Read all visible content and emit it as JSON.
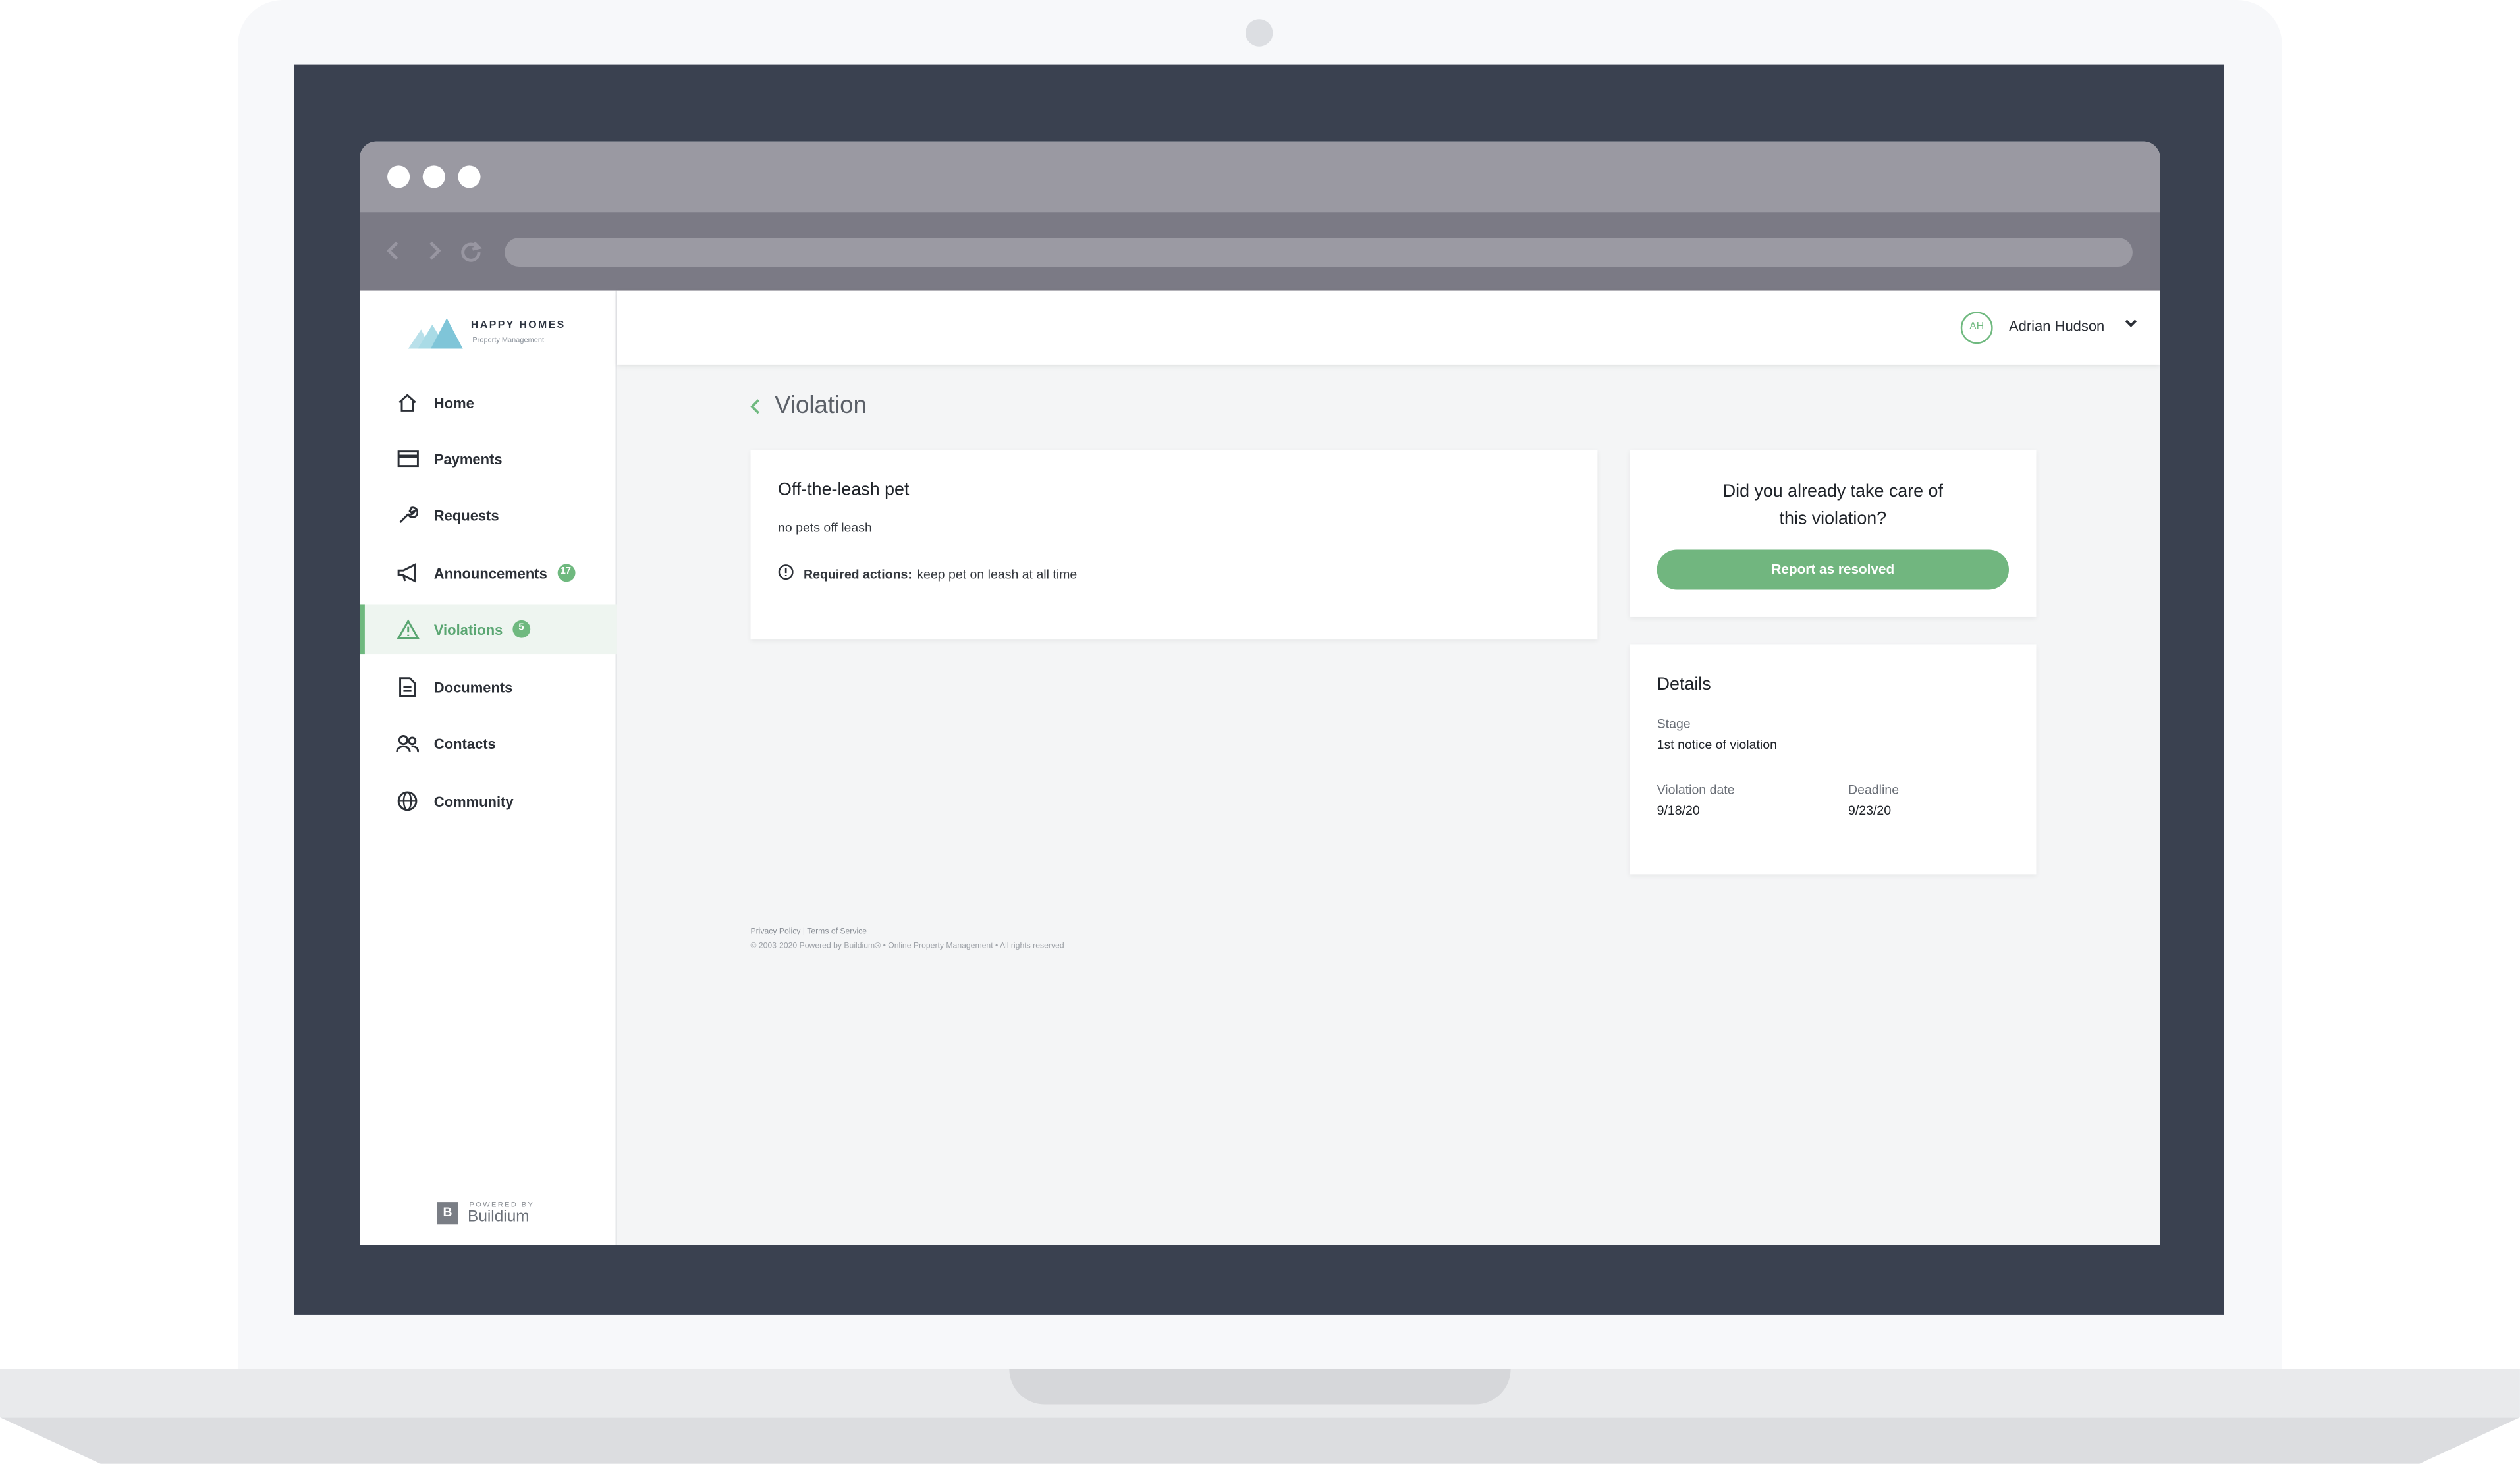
{
  "brand": {
    "name": "HAPPY HOMES",
    "tagline": "Property Management",
    "logo_colors": [
      "#7fc5d8",
      "#a9dbe6"
    ]
  },
  "browser": {
    "back_icon": "chevron-left-icon",
    "forward_icon": "chevron-right-icon",
    "reload_icon": "reload-icon"
  },
  "sidebar": {
    "items": [
      {
        "label": "Home",
        "icon": "home-icon"
      },
      {
        "label": "Payments",
        "icon": "credit-card-icon"
      },
      {
        "label": "Requests",
        "icon": "wrench-icon"
      },
      {
        "label": "Announcements",
        "icon": "megaphone-icon",
        "badge": "17"
      },
      {
        "label": "Violations",
        "icon": "warning-icon",
        "badge": "5",
        "active": true
      },
      {
        "label": "Documents",
        "icon": "document-icon"
      },
      {
        "label": "Contacts",
        "icon": "contacts-icon"
      },
      {
        "label": "Community",
        "icon": "globe-icon"
      }
    ],
    "powered_by": "POWERED BY",
    "powered_name": "Buildium",
    "powered_icon": "B"
  },
  "header": {
    "avatar_initials": "AH",
    "user_name": "Adrian Hudson"
  },
  "page": {
    "title": "Violation"
  },
  "violation": {
    "title": "Off-the-leash pet",
    "description": "no pets off leash",
    "required_label": "Required actions:",
    "required_text": "keep pet on leash at all time"
  },
  "resolve": {
    "question_line1": "Did you already take care of",
    "question_line2": "this violation?",
    "button_label": "Report as resolved"
  },
  "details": {
    "title": "Details",
    "stage_label": "Stage",
    "stage_value": "1st notice of violation",
    "date_label": "Violation date",
    "date_value": "9/18/20",
    "deadline_label": "Deadline",
    "deadline_value": "9/23/20"
  },
  "footer": {
    "privacy": "Privacy Policy",
    "separator": "|",
    "terms": "Terms of Service",
    "copyright": "© 2003-2020 Powered by Buildium® • Online Property Management • All rights reserved"
  },
  "colors": {
    "accent": "#6fb97f",
    "sidebar_active_bg": "#eef5f0",
    "bezel": "#3a4150"
  }
}
